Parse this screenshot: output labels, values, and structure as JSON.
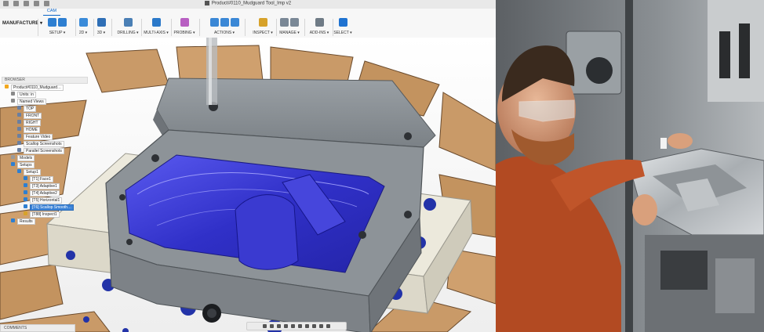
{
  "app": {
    "workspace_label": "MANUFACTURE ▾",
    "workspace_tab": "CAM",
    "document_title": "Product#0110_Mudguard Tool_Imp v2",
    "ribbon_groups": [
      {
        "label": "SETUP ▾",
        "color": "#2e7fd1"
      },
      {
        "label": "2D ▾",
        "color": "#3a8bd9"
      },
      {
        "label": "3D ▾",
        "color": "#2f6fb6"
      },
      {
        "label": "DRILLING ▾",
        "color": "#4a7fb5"
      },
      {
        "label": "MULTI-AXIS ▾",
        "color": "#2b79c9"
      },
      {
        "label": "PROBING ▾",
        "color": "#b85fc2"
      },
      {
        "label": "ACTIONS ▾",
        "color": "#3b88d6"
      },
      {
        "label": "INSPECT ▾",
        "color": "#d7a22a"
      },
      {
        "label": "MANAGE ▾",
        "color": "#7a8896"
      },
      {
        "label": "ADD-INS ▾",
        "color": "#6f7b86"
      },
      {
        "label": "SELECT ▾",
        "color": "#1f73d1"
      }
    ],
    "browser": {
      "header": "BROWSER",
      "items": [
        {
          "label": "Product#0110_Mudguard…",
          "depth": 0
        },
        {
          "label": "Units: in",
          "depth": 1
        },
        {
          "label": "Named Views",
          "depth": 1
        },
        {
          "label": "TOP",
          "depth": 2
        },
        {
          "label": "FRONT",
          "depth": 2
        },
        {
          "label": "RIGHT",
          "depth": 2
        },
        {
          "label": "HOME",
          "depth": 2
        },
        {
          "label": "Feature Video",
          "depth": 2
        },
        {
          "label": "Scallop Screenshots",
          "depth": 2
        },
        {
          "label": "Parallel Screenshots",
          "depth": 2
        },
        {
          "label": "Models",
          "depth": 1
        },
        {
          "label": "Setups",
          "depth": 1
        },
        {
          "label": "Setup1",
          "depth": 2
        },
        {
          "label": "[T1] Face1",
          "depth": 3
        },
        {
          "label": "[T3] Adaptive1",
          "depth": 3
        },
        {
          "label": "[T4] Adaptive2",
          "depth": 3
        },
        {
          "label": "[T5] Horizontal1",
          "depth": 3
        },
        {
          "label": "[T6] Scallop Smooth…",
          "depth": 3,
          "selected": true
        },
        {
          "label": "[T88] Inspect1",
          "depth": 3
        },
        {
          "label": "Results",
          "depth": 1
        }
      ]
    },
    "comments_label": "COMMENTS",
    "colors": {
      "toolpath": "#3b3bd8",
      "block": "#8d9398",
      "fixture": "#e9e6d8",
      "table_wood": "#c99a68",
      "accent": "#1f73d1"
    }
  }
}
